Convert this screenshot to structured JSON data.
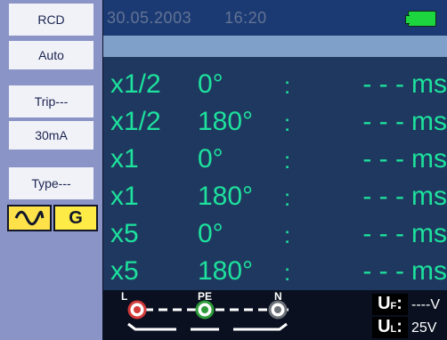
{
  "sidebar": {
    "items": [
      {
        "label": "RCD"
      },
      {
        "label": "Auto"
      },
      {
        "label": "Trip---"
      },
      {
        "label": "30mA"
      },
      {
        "label": "Type---"
      }
    ],
    "type_options": [
      "sine-icon",
      "G"
    ]
  },
  "header": {
    "date": "30.05.2003",
    "time": "16:20",
    "battery_icon": "battery-icon",
    "battery_color": "#1dd63f"
  },
  "main": {
    "rows": [
      {
        "mult": "x1/2",
        "phase": "0°",
        "colon": ":",
        "value": "- - -",
        "unit": "ms"
      },
      {
        "mult": "x1/2",
        "phase": "180°",
        "colon": ":",
        "value": "- - -",
        "unit": "ms"
      },
      {
        "mult": "x1",
        "phase": "0°",
        "colon": ":",
        "value": "- - -",
        "unit": "ms"
      },
      {
        "mult": "x1",
        "phase": "180°",
        "colon": ":",
        "value": "- - -",
        "unit": "ms"
      },
      {
        "mult": "x5",
        "phase": "0°",
        "colon": ":",
        "value": "- - -",
        "unit": "ms"
      },
      {
        "mult": "x5",
        "phase": "180°",
        "colon": ":",
        "value": "- - -",
        "unit": "ms"
      }
    ]
  },
  "bottom": {
    "terminals": [
      {
        "label": "L",
        "color": "#d33b3b"
      },
      {
        "label": "PE",
        "color": "#2e9b3b"
      },
      {
        "label": "N",
        "color": "#6c7078"
      }
    ],
    "uf": {
      "label": "U",
      "sub": "F",
      "value": "----V"
    },
    "ul": {
      "label": "U",
      "sub": "L",
      "value": "25V"
    }
  },
  "colors": {
    "accent": "#1de19d",
    "header": "#1b3a73",
    "sidebar": "#8a94c6"
  }
}
